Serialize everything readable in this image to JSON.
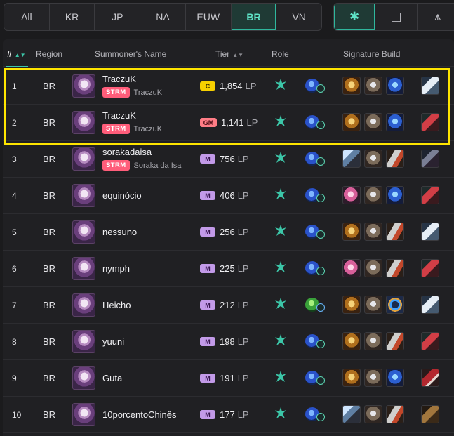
{
  "region_tabs": [
    "All",
    "KR",
    "JP",
    "NA",
    "EUW",
    "BR",
    "VN"
  ],
  "active_region_tab": "BR",
  "filters": [
    {
      "icon": "asterisk-icon",
      "glyph": "✱",
      "active": true
    },
    {
      "icon": "square-icon",
      "glyph": "◫",
      "active": false
    },
    {
      "icon": "grass-icon",
      "glyph": "⩚",
      "active": false
    }
  ],
  "header": {
    "rank": "#",
    "region": "Region",
    "summoner": "Summoner's Name",
    "tier": "Tier",
    "role": "Role",
    "build": "Signature Build"
  },
  "rows": [
    {
      "rank": "1",
      "region": "BR",
      "name": "TraczuK",
      "team": "STRM",
      "team_player": "TraczuK",
      "tier": "C",
      "lp": "1,854",
      "unit": "LP",
      "rune": "blue",
      "items": [
        "it-gold",
        "it-crest",
        "it-blue"
      ],
      "boots": "bt-white"
    },
    {
      "rank": "2",
      "region": "BR",
      "name": "TraczuK",
      "team": "STRM",
      "team_player": "TraczuK",
      "tier": "GM",
      "lp": "1,141",
      "unit": "LP",
      "rune": "blue",
      "items": [
        "it-gold",
        "it-crest",
        "it-blue"
      ],
      "boots": "bt-red"
    },
    {
      "rank": "3",
      "region": "BR",
      "name": "sorakadaisa",
      "team": "STRM",
      "team_player": "Soraka da Isa",
      "tier": "M",
      "lp": "756",
      "unit": "LP",
      "rune": "blue",
      "items": [
        "it-blade",
        "it-crest",
        "it-feather"
      ],
      "boots": "bt-dark"
    },
    {
      "rank": "4",
      "region": "BR",
      "name": "equinócio",
      "team": "",
      "team_player": "",
      "tier": "M",
      "lp": "406",
      "unit": "LP",
      "rune": "blue",
      "items": [
        "it-pink",
        "it-crest",
        "it-blue"
      ],
      "boots": "bt-red"
    },
    {
      "rank": "5",
      "region": "BR",
      "name": "nessuno",
      "team": "",
      "team_player": "",
      "tier": "M",
      "lp": "256",
      "unit": "LP",
      "rune": "blue",
      "items": [
        "it-gold",
        "it-crest",
        "it-feather"
      ],
      "boots": "bt-white"
    },
    {
      "rank": "6",
      "region": "BR",
      "name": "nymph",
      "team": "",
      "team_player": "",
      "tier": "M",
      "lp": "225",
      "unit": "LP",
      "rune": "blue",
      "items": [
        "it-pink",
        "it-crest",
        "it-feather"
      ],
      "boots": "bt-red"
    },
    {
      "rank": "7",
      "region": "BR",
      "name": "Heicho",
      "team": "",
      "team_player": "",
      "tier": "M",
      "lp": "212",
      "unit": "LP",
      "rune": "green",
      "items": [
        "it-gold",
        "it-crest",
        "it-ring"
      ],
      "boots": "bt-white"
    },
    {
      "rank": "8",
      "region": "BR",
      "name": "yuuni",
      "team": "",
      "team_player": "",
      "tier": "M",
      "lp": "198",
      "unit": "LP",
      "rune": "blue",
      "items": [
        "it-gold",
        "it-crest",
        "it-feather"
      ],
      "boots": "bt-red"
    },
    {
      "rank": "9",
      "region": "BR",
      "name": "Guta",
      "team": "",
      "team_player": "",
      "tier": "M",
      "lp": "191",
      "unit": "LP",
      "rune": "blue",
      "items": [
        "it-gold",
        "it-crest",
        "it-blue"
      ],
      "boots": "bt-crim"
    },
    {
      "rank": "10",
      "region": "BR",
      "name": "10porcentoChinês",
      "team": "",
      "team_player": "",
      "tier": "M",
      "lp": "177",
      "unit": "LP",
      "rune": "blue",
      "items": [
        "it-blade",
        "it-crest",
        "it-feather"
      ],
      "boots": "bt-brown"
    }
  ],
  "colors": {
    "accent": "#3cc6a8",
    "highlight": "#ffe500",
    "team_tag": "#ff5d7a",
    "tier_C": "#f7d000",
    "tier_GM": "#ff7d86",
    "tier_M": "#c29ae8"
  }
}
